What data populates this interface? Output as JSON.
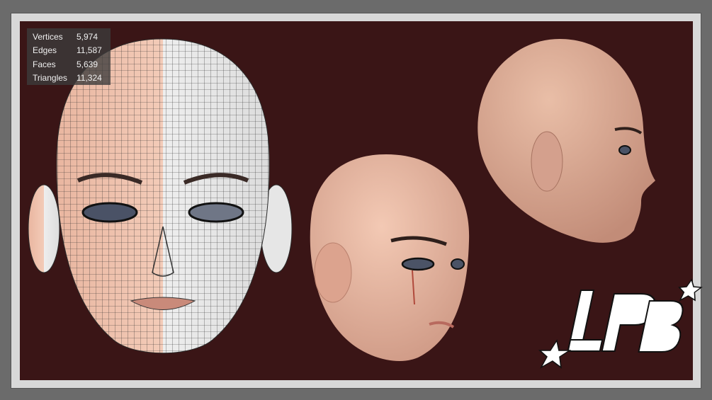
{
  "stats": [
    {
      "label": "Vertices",
      "value": "5,974"
    },
    {
      "label": "Edges",
      "value": "11,587"
    },
    {
      "label": "Faces",
      "value": "5,639"
    },
    {
      "label": "Triangles",
      "value": "11,324"
    }
  ],
  "logo": "LPB",
  "colors": {
    "background": "#3a1516",
    "frame": "#d8d8d8",
    "skin": "#e6b7a3",
    "wire": "#2a2a2a"
  }
}
